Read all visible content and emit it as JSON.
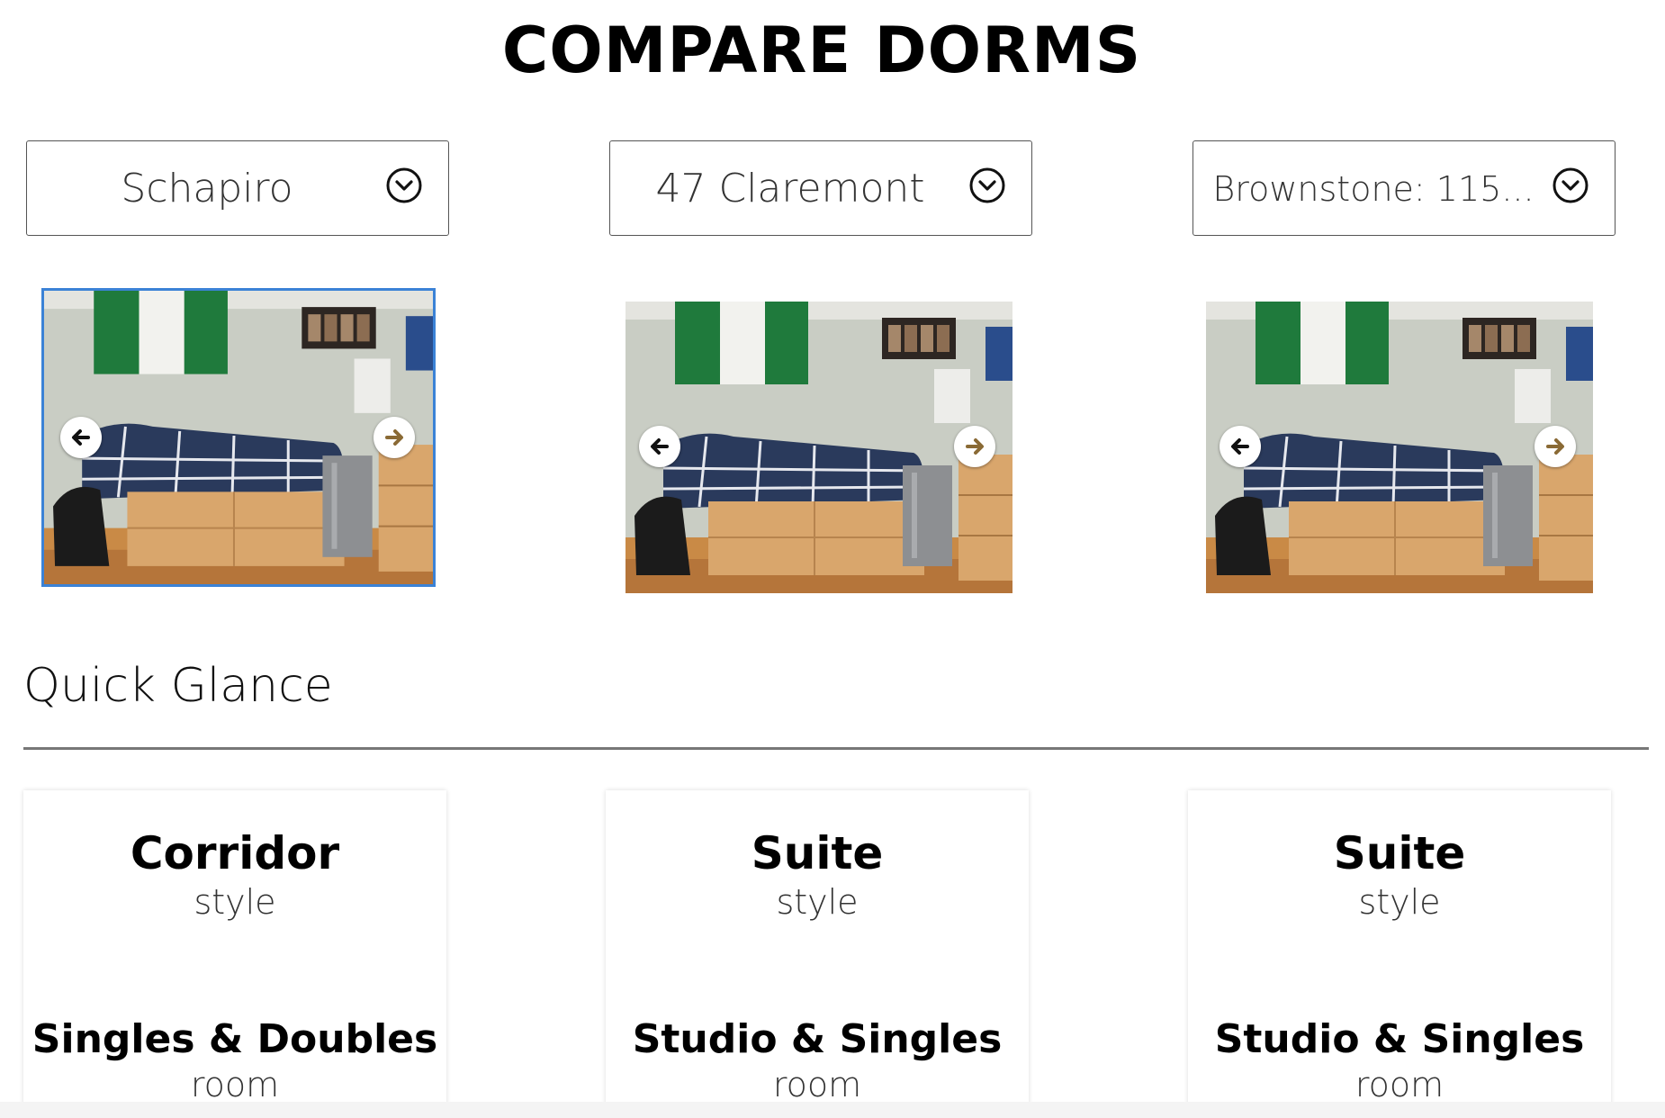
{
  "header": {
    "title": "COMPARE DORMS"
  },
  "selectors": [
    {
      "value": "Schapiro"
    },
    {
      "value": "47 Claremont"
    },
    {
      "value": "Brownstone: 115..."
    }
  ],
  "carousel": {
    "prev_icon": "arrow-left-icon",
    "next_icon": "arrow-right-icon",
    "active_index": 0
  },
  "quick_glance": {
    "title": "Quick Glance",
    "cards": [
      {
        "style_value": "Corridor",
        "style_label": "style",
        "room_value": "Singles & Doubles",
        "room_label": "room"
      },
      {
        "style_value": "Suite",
        "style_label": "style",
        "room_value": "Studio & Singles",
        "room_label": "room"
      },
      {
        "style_value": "Suite",
        "style_label": "style",
        "room_value": "Studio & Singles",
        "room_label": "room"
      }
    ]
  },
  "colors": {
    "accent": "#3b82d6",
    "divider": "#777777",
    "flag_green": "#1f7a3c",
    "bedspread": "#2a3a5c"
  }
}
